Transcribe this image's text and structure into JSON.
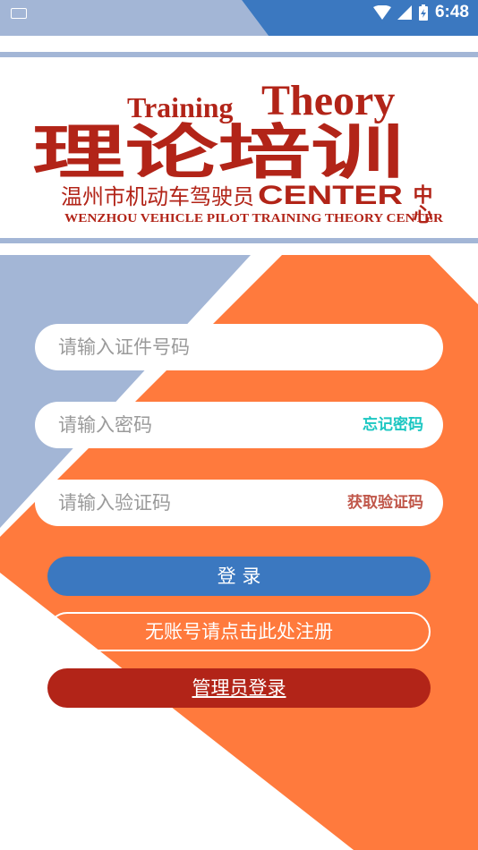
{
  "status_bar": {
    "time": "6:48"
  },
  "logo": {
    "title_training": "Training",
    "title_theory": "Theory",
    "title_cn": "理论培训",
    "side_cn": "中心",
    "subtitle_cn": "温州市机动车驾驶员",
    "subtitle_center": "CENTER",
    "tagline_en": "WENZHOU VEHICLE PILOT TRAINING THEORY CENTER"
  },
  "form": {
    "id_placeholder": "请输入证件号码",
    "password_placeholder": "请输入密码",
    "forgot_password": "忘记密码",
    "code_placeholder": "请输入验证码",
    "get_code": "获取验证码"
  },
  "buttons": {
    "login": "登 录",
    "register": "无账号请点击此处注册",
    "admin_login": "管理员登录"
  },
  "colors": {
    "blue": "#3b78c0",
    "orange": "#ff7a3d",
    "red": "#b22418",
    "teal": "#1cc7c2",
    "logo_red": "#b22418",
    "light_blue": "#a3b6d6"
  }
}
